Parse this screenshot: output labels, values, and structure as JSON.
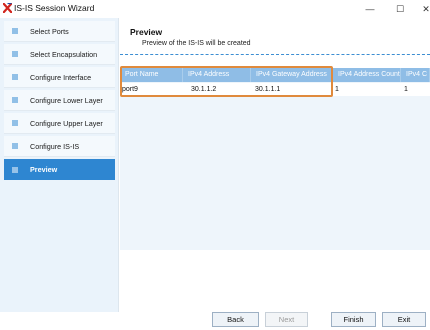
{
  "window": {
    "title": "IS-IS Session Wizard",
    "minimize_glyph": "—",
    "maximize_glyph": "☐",
    "close_glyph": "✕"
  },
  "sidebar": {
    "items": [
      {
        "label": "Select Ports",
        "icon": "list-icon",
        "active": false
      },
      {
        "label": "Select Encapsulation",
        "icon": "list-icon",
        "active": false
      },
      {
        "label": "Configure Interface",
        "icon": "list-icon",
        "active": false
      },
      {
        "label": "Configure Lower Layer",
        "icon": "list-icon",
        "active": false
      },
      {
        "label": "Configure Upper Layer",
        "icon": "list-icon",
        "active": false
      },
      {
        "label": "Configure IS-IS",
        "icon": "list-icon",
        "active": false
      },
      {
        "label": "Preview",
        "icon": "list-icon",
        "active": true
      }
    ]
  },
  "main": {
    "title": "Preview",
    "subtitle": "Preview of the IS-IS will be created"
  },
  "grid": {
    "columns": [
      "Port Name",
      "IPv4 Address",
      "IPv4 Gateway Address",
      "IPv4 Address Count",
      "IPv4 C"
    ],
    "rows": [
      [
        "port9",
        "30.1.1.2",
        "30.1.1.1",
        "1",
        "1"
      ]
    ]
  },
  "footer": {
    "back_label": "Back",
    "next_label": "Next",
    "finish_label": "Finish",
    "exit_label": "Exit"
  },
  "colors": {
    "accent": "#2e86d1",
    "grid_header": "#8fbde6",
    "highlight": "#e08a3c",
    "sidebar_bg": "#eaf3fb"
  }
}
